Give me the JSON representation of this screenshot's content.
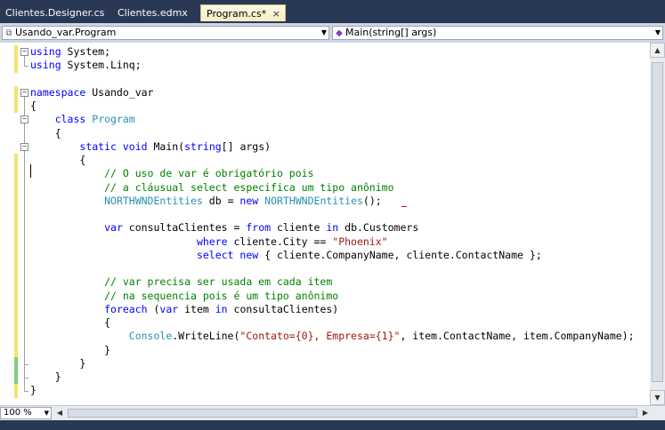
{
  "tabs": [
    {
      "label": "Clientes.Designer.cs",
      "active": false
    },
    {
      "label": "Clientes.edmx",
      "active": false
    },
    {
      "label": "Program.cs*",
      "active": true,
      "close": "×"
    }
  ],
  "navbar": {
    "type_selector": "Usando_var.Program",
    "member_selector": "Main(string[] args)",
    "type_icon": "class-icon",
    "member_icon": "method-icon"
  },
  "zoom": "100 %",
  "colors": {
    "keyword": "#0000ff",
    "type": "#2b91af",
    "comment": "#008000",
    "string": "#a31515",
    "changed_saved": "#7fcf7f",
    "changed_unsaved": "#f5e46d"
  },
  "code": [
    [
      {
        "c": "kw",
        "t": "using"
      },
      {
        "c": "tx",
        "t": " System;"
      }
    ],
    [
      {
        "c": "kw",
        "t": "using"
      },
      {
        "c": "tx",
        "t": " System.Linq;"
      }
    ],
    [],
    [
      {
        "c": "kw",
        "t": "namespace"
      },
      {
        "c": "tx",
        "t": " Usando_var"
      }
    ],
    [
      {
        "c": "tx",
        "t": "{"
      }
    ],
    [
      {
        "c": "tx",
        "t": "    "
      },
      {
        "c": "kw",
        "t": "class"
      },
      {
        "c": "tx",
        "t": " "
      },
      {
        "c": "ty",
        "t": "Program"
      }
    ],
    [
      {
        "c": "tx",
        "t": "    {"
      }
    ],
    [
      {
        "c": "tx",
        "t": "        "
      },
      {
        "c": "kw",
        "t": "static"
      },
      {
        "c": "tx",
        "t": " "
      },
      {
        "c": "kw",
        "t": "void"
      },
      {
        "c": "tx",
        "t": " Main("
      },
      {
        "c": "kw",
        "t": "string"
      },
      {
        "c": "tx",
        "t": "[] args)"
      }
    ],
    [
      {
        "c": "tx",
        "t": "        {"
      }
    ],
    [
      {
        "c": "tx",
        "t": "            "
      },
      {
        "c": "cm",
        "t": "// O uso de var é obrigatório pois"
      }
    ],
    [
      {
        "c": "tx",
        "t": "            "
      },
      {
        "c": "cm",
        "t": "// a cláusual select especifica um tipo anônimo"
      }
    ],
    [
      {
        "c": "tx",
        "t": "            "
      },
      {
        "c": "ty",
        "t": "NORTHWNDEntities"
      },
      {
        "c": "tx",
        "t": " db = "
      },
      {
        "c": "kw",
        "t": "new"
      },
      {
        "c": "tx",
        "t": " "
      },
      {
        "c": "ty",
        "t": "NORTHWNDEntities"
      },
      {
        "c": "tx",
        "t": "();"
      }
    ],
    [],
    [
      {
        "c": "tx",
        "t": "            "
      },
      {
        "c": "kw",
        "t": "var"
      },
      {
        "c": "tx",
        "t": " consultaClientes = "
      },
      {
        "c": "kw",
        "t": "from"
      },
      {
        "c": "tx",
        "t": " cliente "
      },
      {
        "c": "kw",
        "t": "in"
      },
      {
        "c": "tx",
        "t": " db.Customers"
      }
    ],
    [
      {
        "c": "tx",
        "t": "                           "
      },
      {
        "c": "kw",
        "t": "where"
      },
      {
        "c": "tx",
        "t": " cliente.City == "
      },
      {
        "c": "st",
        "t": "\"Phoenix\""
      }
    ],
    [
      {
        "c": "tx",
        "t": "                           "
      },
      {
        "c": "kw",
        "t": "select"
      },
      {
        "c": "tx",
        "t": " "
      },
      {
        "c": "kw",
        "t": "new"
      },
      {
        "c": "tx",
        "t": " { cliente.CompanyName, cliente.ContactName };"
      }
    ],
    [],
    [
      {
        "c": "tx",
        "t": "            "
      },
      {
        "c": "cm",
        "t": "// var precisa ser usada em cada item"
      }
    ],
    [
      {
        "c": "tx",
        "t": "            "
      },
      {
        "c": "cm",
        "t": "// na sequencia pois é um tipo anônimo"
      }
    ],
    [
      {
        "c": "tx",
        "t": "            "
      },
      {
        "c": "kw",
        "t": "foreach"
      },
      {
        "c": "tx",
        "t": " ("
      },
      {
        "c": "kw",
        "t": "var"
      },
      {
        "c": "tx",
        "t": " item "
      },
      {
        "c": "kw",
        "t": "in"
      },
      {
        "c": "tx",
        "t": " consultaClientes)"
      }
    ],
    [
      {
        "c": "tx",
        "t": "            {"
      }
    ],
    [
      {
        "c": "tx",
        "t": "                "
      },
      {
        "c": "ty",
        "t": "Console"
      },
      {
        "c": "tx",
        "t": ".WriteLine("
      },
      {
        "c": "st",
        "t": "\"Contato={0}, Empresa={1}\""
      },
      {
        "c": "tx",
        "t": ", item.ContactName, item.CompanyName);"
      }
    ],
    [
      {
        "c": "tx",
        "t": "            }"
      }
    ],
    [
      {
        "c": "tx",
        "t": "        }"
      }
    ],
    [
      {
        "c": "tx",
        "t": "    }"
      }
    ],
    [
      {
        "c": "tx",
        "t": "}"
      }
    ]
  ]
}
